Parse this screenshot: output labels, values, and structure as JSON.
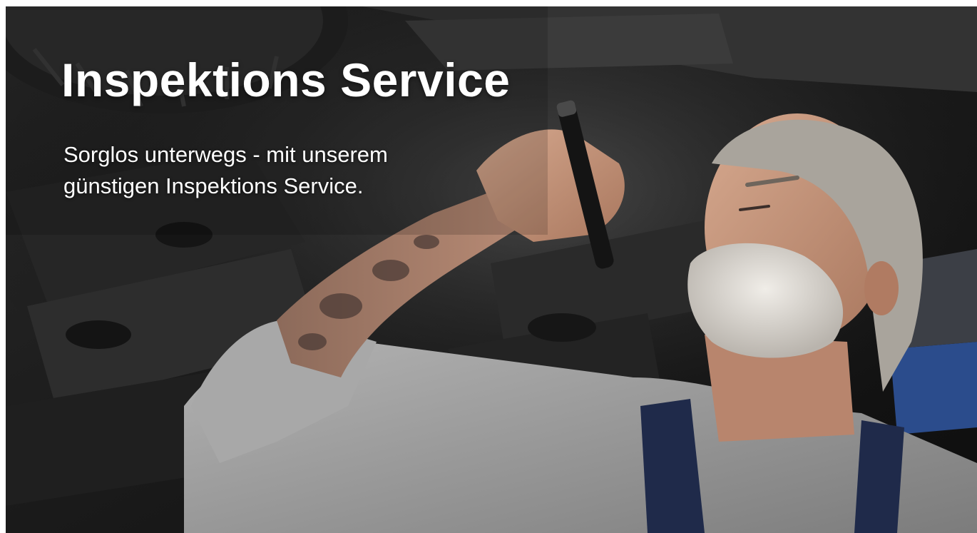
{
  "hero": {
    "title": "Inspektions Service",
    "subtitle_line1": "Sorglos unterwegs - mit unserem",
    "subtitle_line2": "günstigen Inspektions Service.",
    "image_subject": "mechanic-under-car-with-flashlight"
  },
  "colors": {
    "text": "#ffffff",
    "background_dark": "#1c1c1c",
    "shirt_gray": "#9a9a9a",
    "overall_navy": "#1f2a4a",
    "accent_blue": "#2b4c8c"
  }
}
